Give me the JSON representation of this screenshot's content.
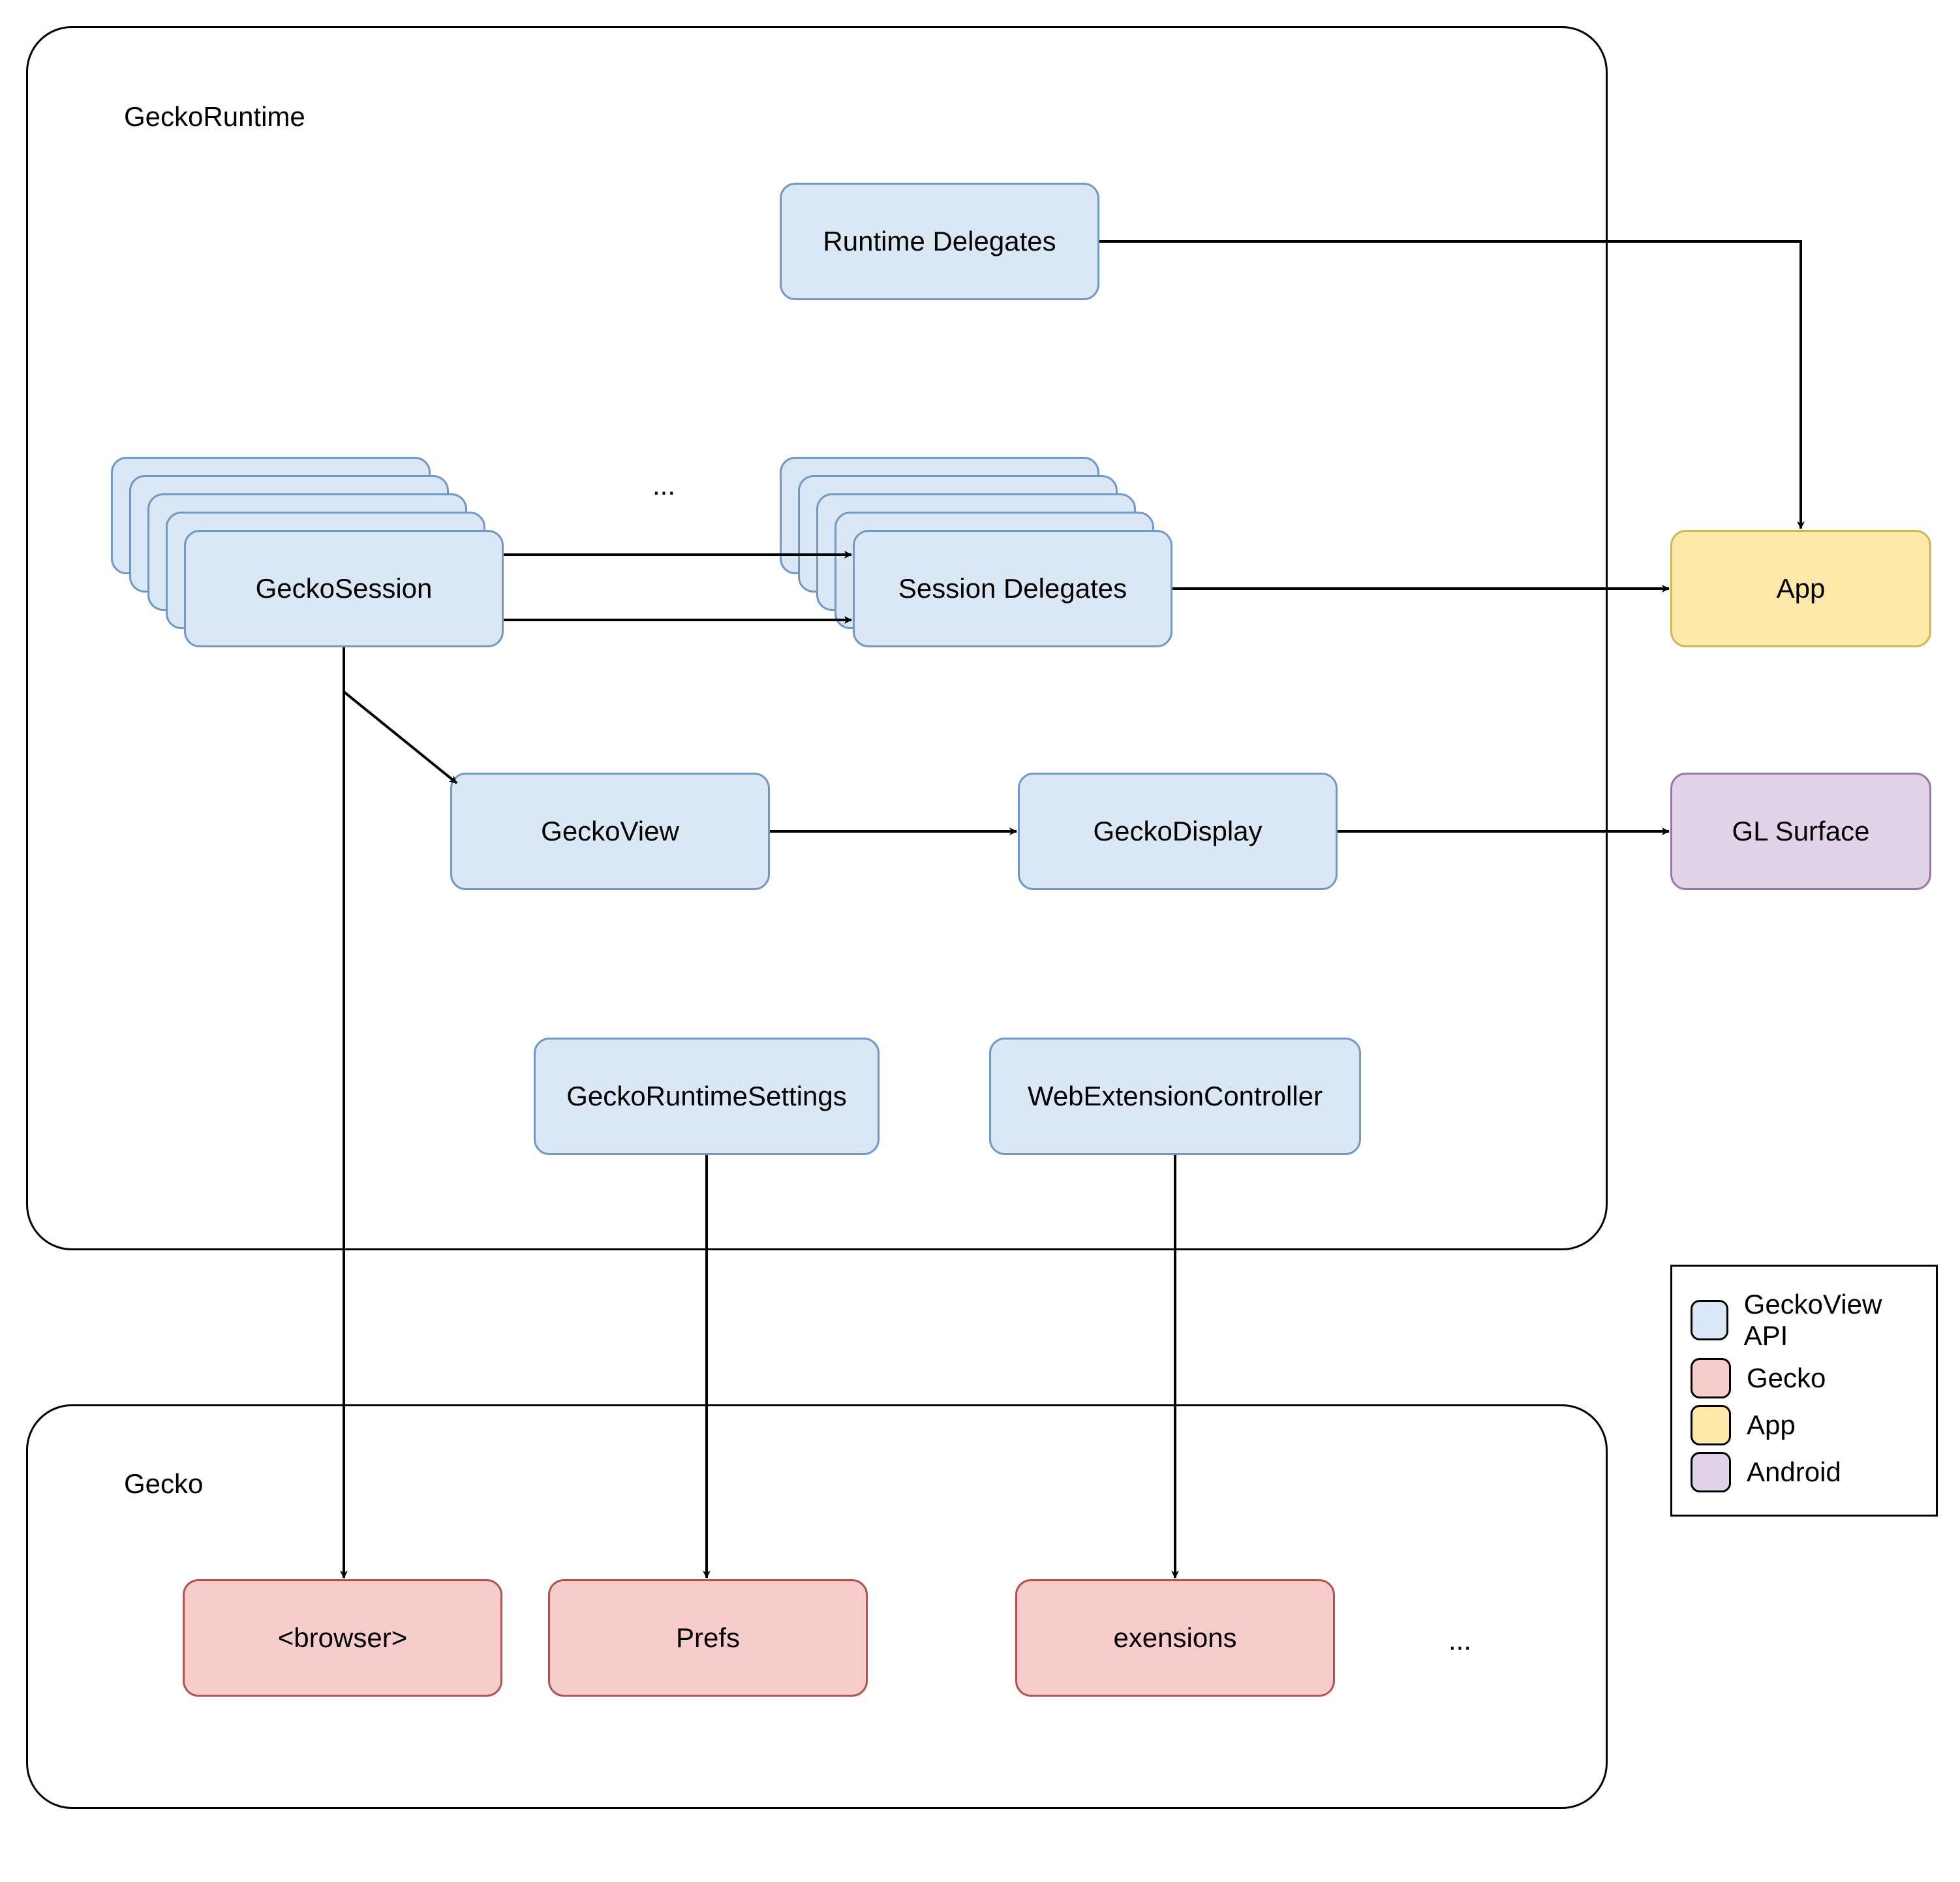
{
  "containers": {
    "geckoRuntime": "GeckoRuntime",
    "gecko": "Gecko"
  },
  "nodes": {
    "runtimeDelegates": "Runtime Delegates",
    "geckoSession": "GeckoSession",
    "sessionDelegates": "Session Delegates",
    "geckoView": "GeckoView",
    "geckoDisplay": "GeckoDisplay",
    "geckoRuntimeSettings": "GeckoRuntimeSettings",
    "webExtensionController": "WebExtensionController",
    "app": "App",
    "glSurface": "GL Surface",
    "browser": "<browser>",
    "prefs": "Prefs",
    "extensions": "exensions"
  },
  "ellipses": {
    "sessions": "...",
    "gecko": "..."
  },
  "legend": {
    "geckoViewApi": "GeckoView API",
    "gecko": "Gecko",
    "app": "App",
    "android": "Android"
  },
  "colors": {
    "blueFill": "#dae7f5",
    "blueStroke": "#7299c6",
    "redFill": "#f6cdcb",
    "redStroke": "#b3524e",
    "yellowFill": "#ffe9aa",
    "yellowStroke": "#d1b656",
    "purpleFill": "#e1d3e7",
    "purpleStroke": "#947aa2"
  }
}
